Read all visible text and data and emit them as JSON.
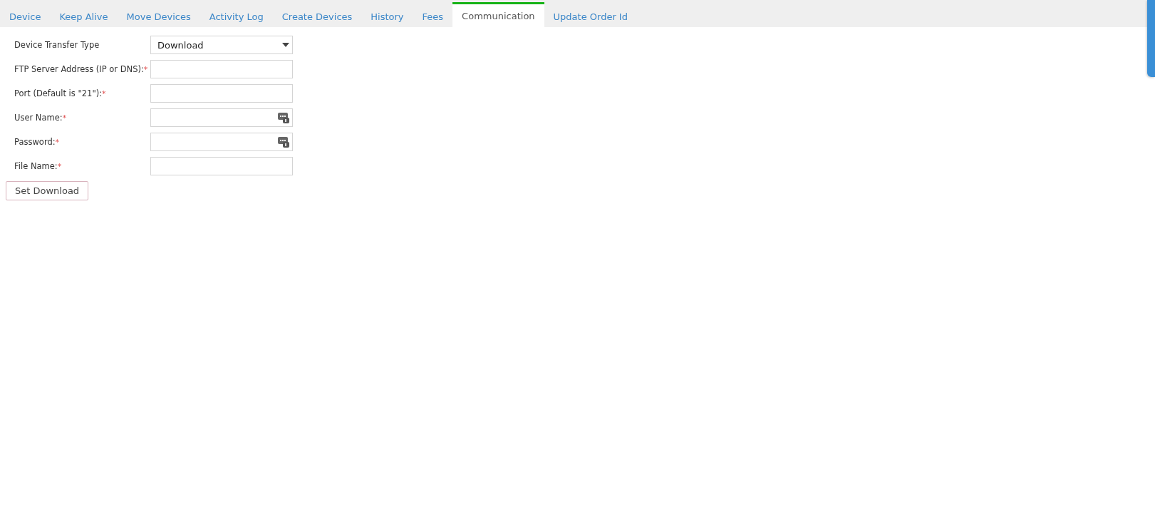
{
  "tabs": [
    {
      "label": "Device",
      "selected": false
    },
    {
      "label": "Keep Alive",
      "selected": false
    },
    {
      "label": "Move Devices",
      "selected": false
    },
    {
      "label": "Activity Log",
      "selected": false
    },
    {
      "label": "Create Devices",
      "selected": false
    },
    {
      "label": "History",
      "selected": false
    },
    {
      "label": "Fees",
      "selected": false
    },
    {
      "label": "Communication",
      "selected": true
    },
    {
      "label": "Update Order Id",
      "selected": false
    }
  ],
  "form": {
    "fields": [
      {
        "kind": "select",
        "label": "Device Transfer Type",
        "value": "Download"
      },
      {
        "kind": "text",
        "label": "FTP Server Address (IP or DNS):",
        "required_mark": "*",
        "autofill_icon": false
      },
      {
        "kind": "text",
        "label": "Port (Default is \"21\"):",
        "required_mark": "*",
        "autofill_icon": false
      },
      {
        "kind": "text",
        "label": "User Name:",
        "required_mark": "*",
        "autofill_icon": true
      },
      {
        "kind": "text",
        "label": "Password:",
        "required_mark": "*",
        "autofill_icon": true
      },
      {
        "kind": "text",
        "label": "File Name:",
        "required_mark": "*",
        "autofill_icon": false
      }
    ],
    "submit": "Set Download"
  }
}
